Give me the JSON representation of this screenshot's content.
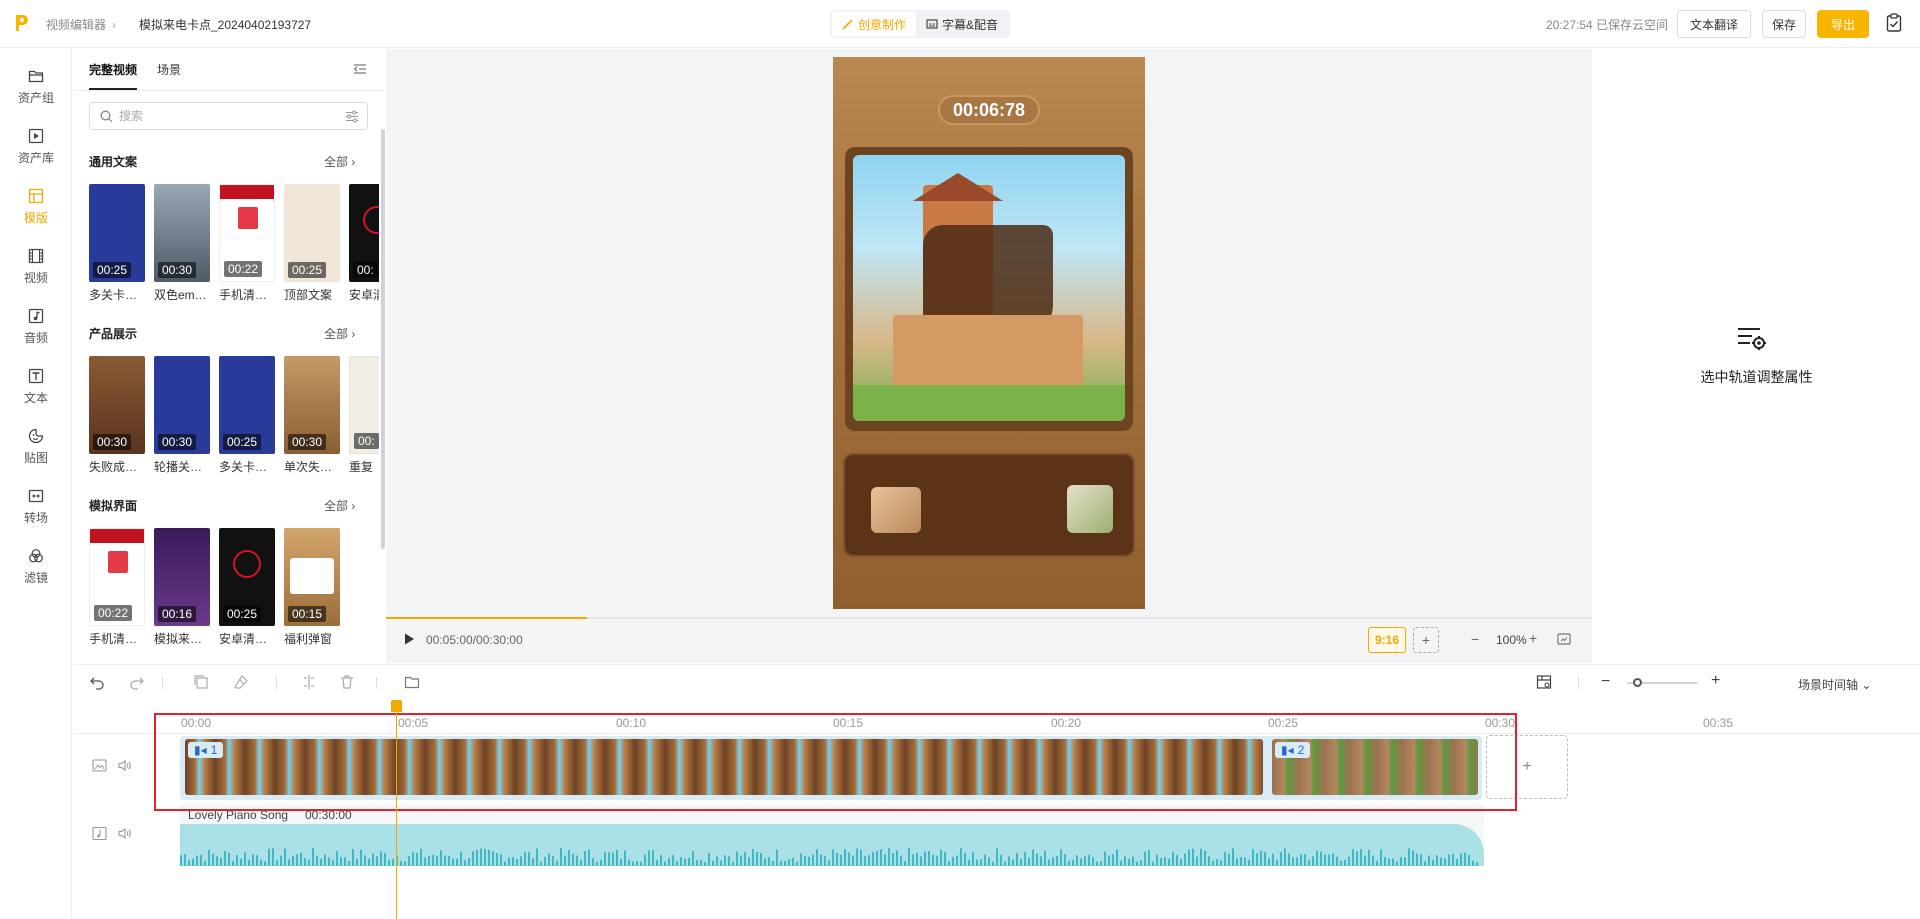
{
  "header": {
    "breadcrumb_root": "视频编辑器",
    "doc_title": "模拟来电卡点_20240402193727",
    "mode_tabs": [
      {
        "label": "创意制作",
        "active": true
      },
      {
        "label": "字幕&配音",
        "active": false
      }
    ],
    "save_status": "20:27:54 已保存云空间",
    "translate_label": "文本翻译",
    "save_label": "保存",
    "export_label": "导出",
    "accent_color": "#f7b500"
  },
  "rail": {
    "items": [
      {
        "label": "资产组",
        "icon": "folder-icon"
      },
      {
        "label": "资产库",
        "icon": "media-library-icon"
      },
      {
        "label": "模版",
        "icon": "template-icon",
        "active": true
      },
      {
        "label": "视频",
        "icon": "film-icon"
      },
      {
        "label": "音频",
        "icon": "music-icon"
      },
      {
        "label": "文本",
        "icon": "text-icon"
      },
      {
        "label": "贴图",
        "icon": "sticker-icon"
      },
      {
        "label": "转场",
        "icon": "transition-icon"
      },
      {
        "label": "滤镜",
        "icon": "filter-icon"
      }
    ]
  },
  "panel": {
    "tabs": [
      {
        "label": "完整视频",
        "active": true
      },
      {
        "label": "场景",
        "active": false
      }
    ],
    "search_placeholder": "搜索",
    "sections": [
      {
        "title": "通用文案",
        "all_label": "全部",
        "items": [
          {
            "label": "多关卡…",
            "duration": "00:25",
            "color": "#283a9a"
          },
          {
            "label": "双色em…",
            "duration": "00:30",
            "color": "#5f6b7a"
          },
          {
            "label": "手机清…",
            "duration": "00:22",
            "color": "#ffffff"
          },
          {
            "label": "顶部文案",
            "duration": "00:25",
            "color": "#efe6d8"
          },
          {
            "label": "安卓清",
            "duration": "00:",
            "color": "#111111"
          }
        ]
      },
      {
        "title": "产品展示",
        "all_label": "全部",
        "items": [
          {
            "label": "失败成…",
            "duration": "00:30",
            "color": "#7a4a2a"
          },
          {
            "label": "轮播关…",
            "duration": "00:30",
            "color": "#283a9a"
          },
          {
            "label": "多关卡…",
            "duration": "00:25",
            "color": "#283a9a"
          },
          {
            "label": "单次失…",
            "duration": "00:30",
            "color": "#a87a4a"
          },
          {
            "label": "重复",
            "duration": "00:",
            "color": "#f2eee6"
          }
        ]
      },
      {
        "title": "模拟界面",
        "all_label": "全部",
        "items": [
          {
            "label": "手机清…",
            "duration": "00:22",
            "color": "#ffffff"
          },
          {
            "label": "模拟来…",
            "duration": "00:16",
            "color": "#4a2a6a"
          },
          {
            "label": "安卓清…",
            "duration": "00:25",
            "color": "#111111"
          },
          {
            "label": "福利弹窗",
            "duration": "00:15",
            "color": "#c99a5a"
          }
        ]
      }
    ]
  },
  "preview": {
    "game_timer": "00:06:78",
    "time": "00:05:00/00:30:00",
    "progress": 0.1667,
    "ratio": "9:16",
    "zoom": "100%"
  },
  "properties": {
    "hint": "选中轨道调整属性"
  },
  "timeline": {
    "scene_axis_label": "场景时间轴",
    "ruler_labels": [
      "00:00",
      "00:05",
      "00:10",
      "00:15",
      "00:20",
      "00:25",
      "00:30",
      "00:35"
    ],
    "clips": [
      {
        "index": "1"
      },
      {
        "index": "2"
      }
    ],
    "audio": {
      "name": "Lovely Piano Song",
      "duration": "00:30:00"
    },
    "highlight_color": "#e5222b"
  }
}
